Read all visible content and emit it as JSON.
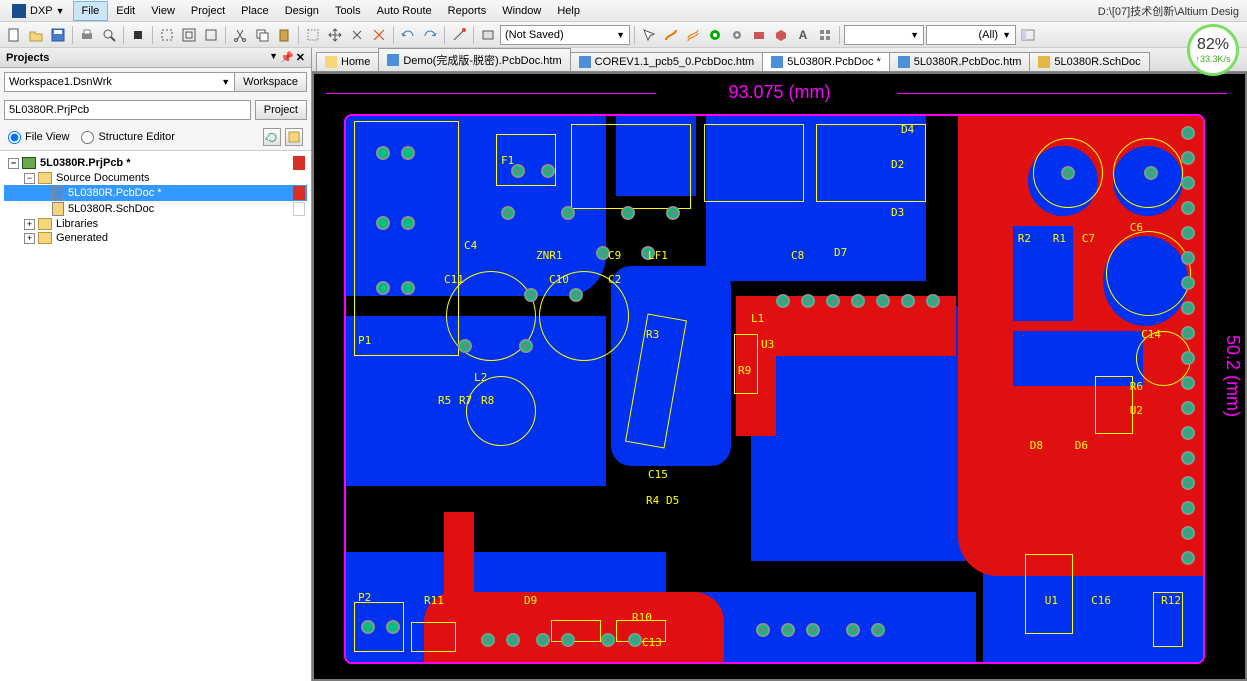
{
  "app": {
    "dxp_label": "DXP",
    "path_display": "D:\\[07]技术创新\\Altium Desig"
  },
  "menu": {
    "file": "File",
    "edit": "Edit",
    "view": "View",
    "project": "Project",
    "place": "Place",
    "design": "Design",
    "tools": "Tools",
    "autoroute": "Auto Route",
    "reports": "Reports",
    "window": "Window",
    "help": "Help"
  },
  "toolbar": {
    "not_saved": "(Not Saved)",
    "all_filter": "(All)"
  },
  "panel": {
    "title": "Projects",
    "workspace_value": "Workspace1.DsnWrk",
    "workspace_btn": "Workspace",
    "project_value": "5L0380R.PrjPcb",
    "project_btn": "Project",
    "file_view": "File View",
    "structure_editor": "Structure Editor"
  },
  "tree": {
    "root": "5L0380R.PrjPcb *",
    "source_docs": "Source Documents",
    "pcb_doc": "5L0380R.PcbDoc *",
    "sch_doc": "5L0380R.SchDoc",
    "libraries": "Libraries",
    "generated": "Generated"
  },
  "tabs": {
    "home": "Home",
    "t1": "Demo(完成版-脱密).PcbDoc.htm",
    "t2": "COREV1.1_pcb5_0.PcbDoc.htm",
    "t3": "5L0380R.PcbDoc *",
    "t4": "5L0380R.PcbDoc.htm",
    "t5": "5L0380R.SchDoc"
  },
  "dimensions": {
    "width": "93.075 (mm)",
    "height": "50.2 (mm)"
  },
  "designators": {
    "P1": "P1",
    "P2": "P2",
    "F1": "F1",
    "C11": "C11",
    "C10": "C10",
    "C2": "C2",
    "C9": "C9",
    "C8": "C8",
    "ZNR1": "ZNR1",
    "LF1": "LF1",
    "L1": "L1",
    "L2": "L2",
    "R3": "R3",
    "R4": "R4",
    "R5": "R5",
    "R7": "R7",
    "R8": "R8",
    "R9": "R9",
    "R10": "R10",
    "R11": "R11",
    "D2": "D2",
    "D3": "D3",
    "D4": "D4",
    "D5": "D5",
    "D7": "D7",
    "D9": "D9",
    "U1": "U1",
    "U2": "U2",
    "U3": "U3",
    "C13": "C13",
    "C15": "C15",
    "C14": "C14",
    "C16": "C16",
    "C6": "C6",
    "C7": "C7",
    "R1": "R1",
    "R2": "R2",
    "R6": "R6",
    "R12": "R12",
    "D6": "D6",
    "D8": "D8",
    "C4": "C4"
  },
  "speed": {
    "pct": "82%",
    "rate": "↑33.3K/s"
  }
}
